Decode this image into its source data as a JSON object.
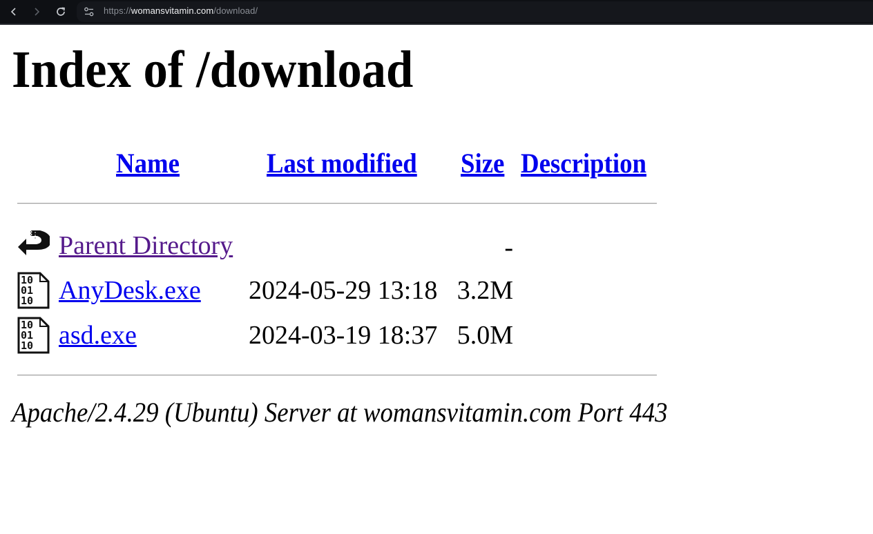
{
  "browser": {
    "url_scheme": "https://",
    "url_host": "womansvitamin.com",
    "url_path": "/download/",
    "back_icon": "chevron-left-icon",
    "forward_icon": "chevron-right-icon",
    "reload_icon": "reload-icon",
    "site_info_icon": "tune-icon"
  },
  "page": {
    "title": "Index of /download",
    "columns": {
      "name": "Name",
      "last_modified": "Last modified",
      "size": "Size",
      "description": "Description"
    },
    "rows": [
      {
        "icon": "back-arrow-icon",
        "name": "Parent Directory",
        "last_modified": "",
        "size": "-",
        "description": "",
        "visited": true
      },
      {
        "icon": "binary-file-icon",
        "name": "AnyDesk.exe",
        "last_modified": "2024-05-29 13:18",
        "size": "3.2M",
        "description": ""
      },
      {
        "icon": "binary-file-icon",
        "name": "asd.exe",
        "last_modified": "2024-03-19 18:37",
        "size": "5.0M",
        "description": ""
      }
    ],
    "footer": "Apache/2.4.29 (Ubuntu) Server at womansvitamin.com Port 443"
  }
}
